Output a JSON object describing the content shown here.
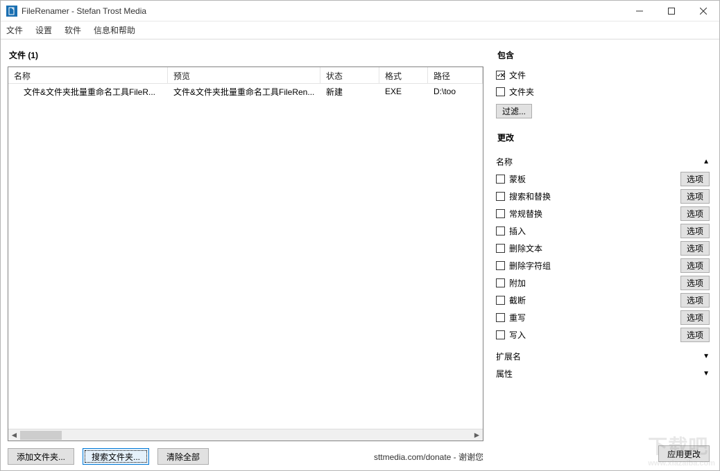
{
  "window": {
    "title": "FileRenamer - Stefan Trost Media"
  },
  "menu": {
    "file": "文件",
    "settings": "设置",
    "software": "软件",
    "help": "信息和帮助"
  },
  "left": {
    "heading": "文件 (1)",
    "columns": {
      "name": "名称",
      "preview": "预览",
      "status": "状态",
      "format": "格式",
      "path": "路径"
    },
    "rows": [
      {
        "name": "文件&文件夹批量重命名工具FileR...",
        "preview": "文件&文件夹批量重命名工具FileRen...",
        "status": "新建",
        "format": "EXE",
        "path": "D:\\too"
      }
    ],
    "btn_add_folder": "添加文件夹...",
    "btn_search_folder": "搜索文件夹...",
    "btn_clear_all": "清除全部",
    "donate_text": "sttmedia.com/donate - 谢谢您"
  },
  "right": {
    "include_title": "包含",
    "include_files_label": "文件",
    "include_files_checked": true,
    "include_folders_label": "文件夹",
    "include_folders_checked": false,
    "filter_btn": "过滤...",
    "changes_title": "更改",
    "group_name": "名称",
    "options_label": "选项",
    "ops": [
      {
        "label": "蒙板",
        "checked": false
      },
      {
        "label": "搜索和替换",
        "checked": false
      },
      {
        "label": "常规替换",
        "checked": false
      },
      {
        "label": "插入",
        "checked": false
      },
      {
        "label": "删除文本",
        "checked": false
      },
      {
        "label": "删除字符组",
        "checked": false
      },
      {
        "label": "附加",
        "checked": false
      },
      {
        "label": "截断",
        "checked": false
      },
      {
        "label": "重写",
        "checked": false
      },
      {
        "label": "写入",
        "checked": false
      }
    ],
    "group_ext": "扩展名",
    "group_attr": "属性",
    "apply_btn": "应用更改"
  },
  "watermark": {
    "main": "下载吧",
    "sub": "www.xiazaiba.com"
  }
}
